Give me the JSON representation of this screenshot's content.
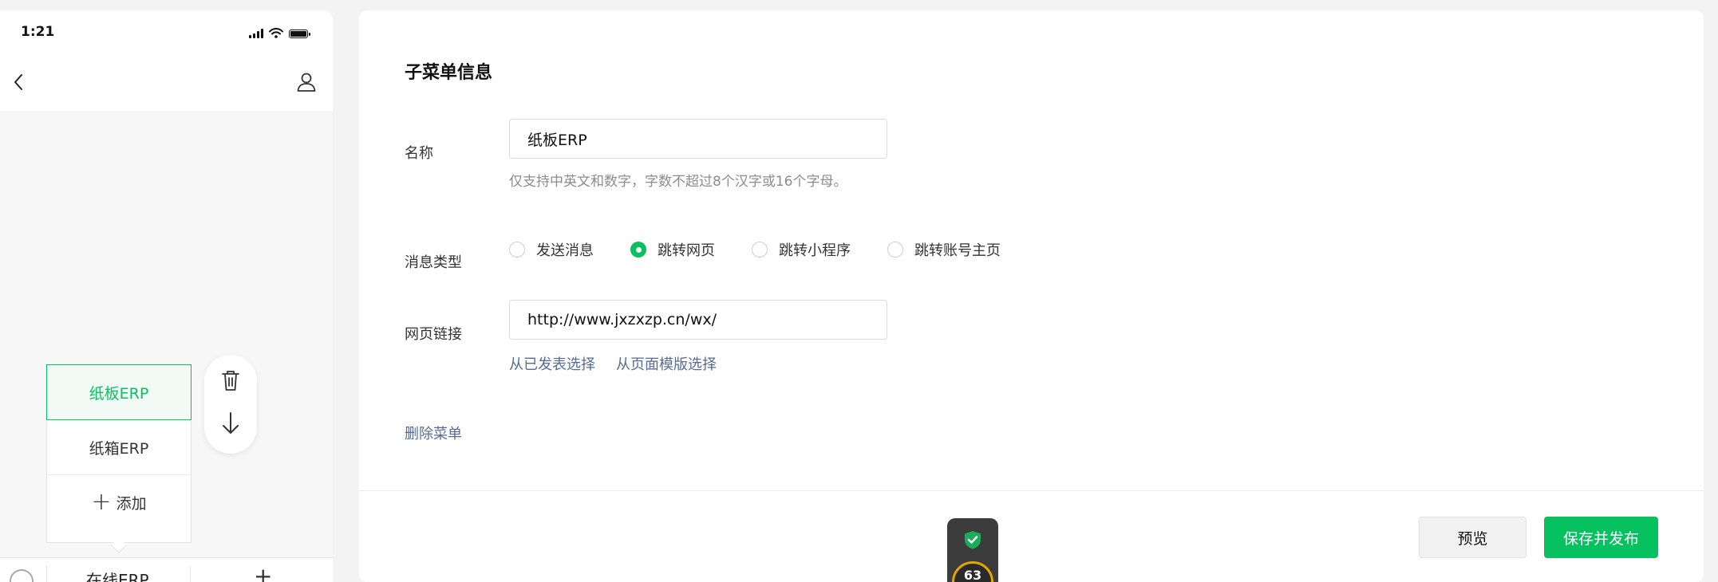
{
  "status_bar": {
    "time": "1:21"
  },
  "submenu": {
    "items": [
      {
        "label": "纸板ERP",
        "active": true
      },
      {
        "label": "纸箱ERP",
        "active": false
      }
    ],
    "add_label": "添加"
  },
  "bottom_menu": {
    "label": "在线ERP"
  },
  "form": {
    "title": "子菜单信息",
    "name_label": "名称",
    "name_value": "纸板ERP",
    "name_hint": "仅支持中英文和数字，字数不超过8个汉字或16个字母。",
    "type_label": "消息类型",
    "type_options": [
      "发送消息",
      "跳转网页",
      "跳转小程序",
      "跳转账号主页"
    ],
    "type_selected": "跳转网页",
    "link_label": "网页链接",
    "link_value": "http://www.jxzxzp.cn/wx/",
    "link_choose_published": "从已发表选择",
    "link_choose_template": "从页面模版选择",
    "delete_label": "删除菜单"
  },
  "footer": {
    "preview_label": "预览",
    "publish_label": "保存并发布"
  },
  "widget": {
    "value": "63"
  },
  "colors": {
    "accent": "#07c160",
    "link": "#576b95",
    "active_bg": "#f1faf4"
  }
}
